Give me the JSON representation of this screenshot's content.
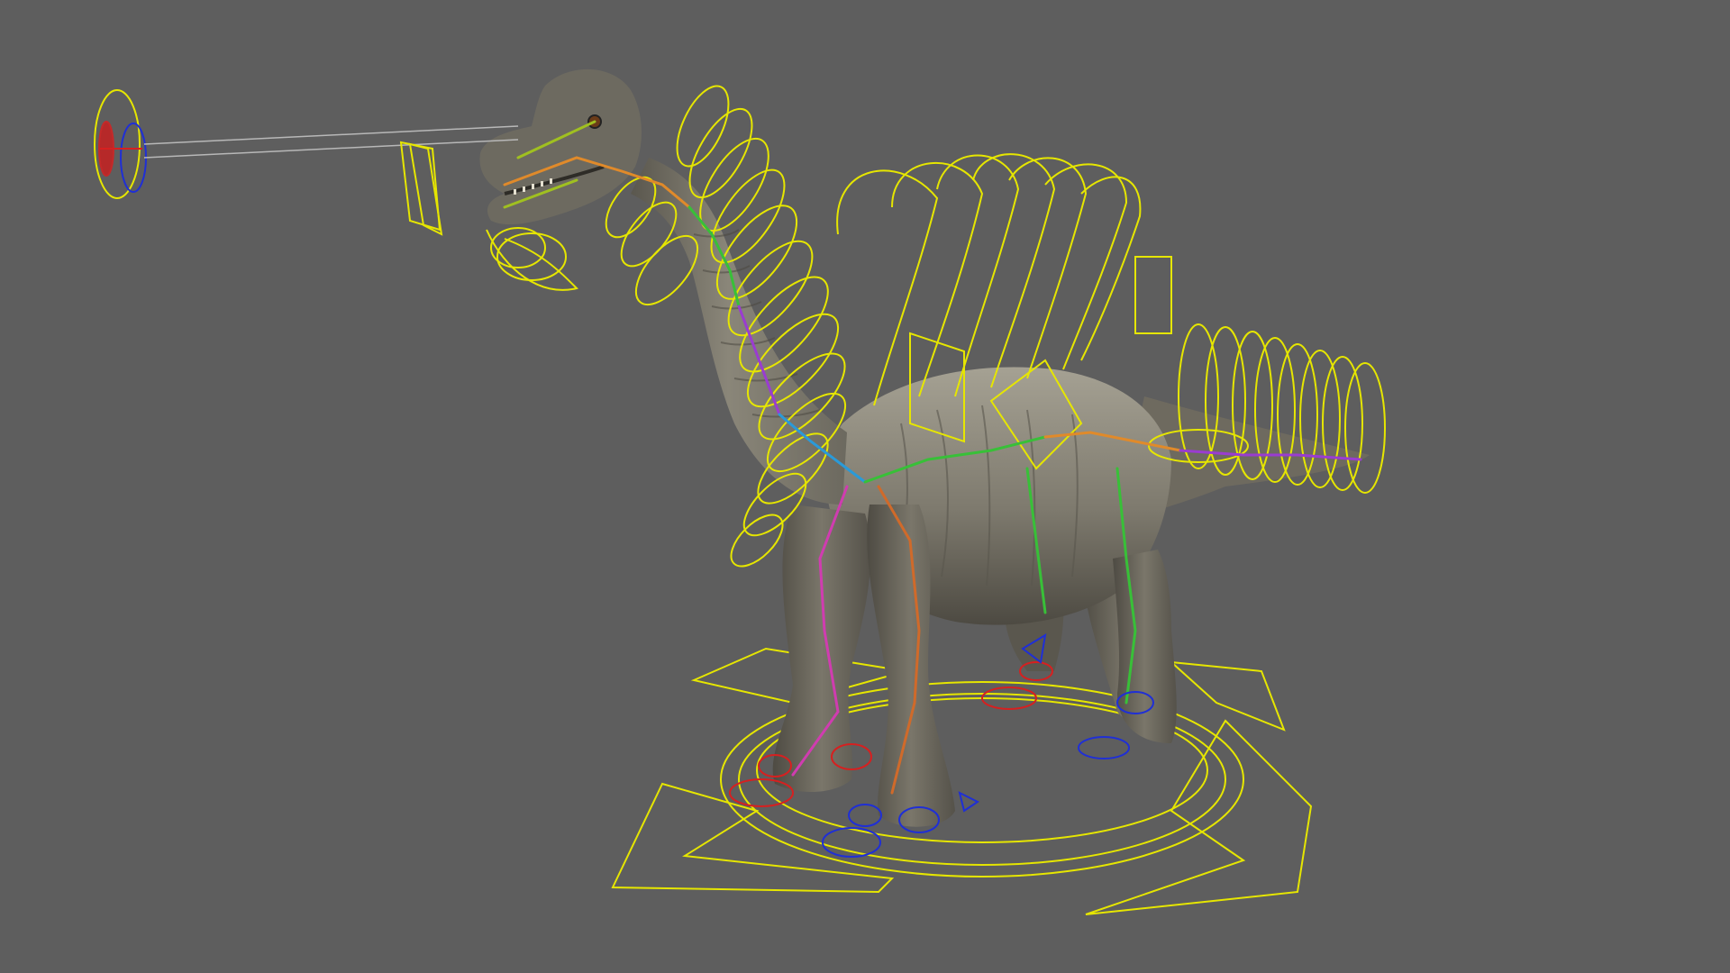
{
  "viewport": {
    "background_color": "#5e5e5e",
    "content": "rigged-brachiosaurus-model",
    "colors": {
      "nurbs_control": "#e6e600",
      "ik_handle_right": "#d62020",
      "ik_handle_left": "#1f2fd6",
      "skin_base": "#7b776b",
      "skin_shadow": "#4a4840",
      "skin_light": "#a39f92",
      "aim_line": "#b8b8b8"
    },
    "icons": [
      "eye-aim-control-icon",
      "root-move-arrows-icon"
    ]
  }
}
